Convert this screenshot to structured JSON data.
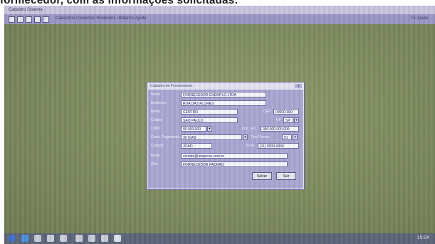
{
  "caption": "formecedor, com as informações solicitadas:",
  "app": {
    "title": "Cadastro Sistema",
    "toolbar_text": "Cadastros Consultas Relatorios Utilitarios Ajuda",
    "toolbar_right": "F1 Ajuda"
  },
  "dialog": {
    "title": "Cadastro de Fornecedores",
    "close_label": "x",
    "fields": [
      {
        "label": "Nome",
        "value": "FORNECEDOR EXEMPLO LTDA"
      },
      {
        "label": "Endereço",
        "value": "RUA DAS FLORES"
      },
      {
        "label": "Bairro",
        "value": "CENTRO",
        "sub_label": "CEP",
        "sub_value": "00000-000"
      },
      {
        "label": "Cidade",
        "value": "SAO PAULO",
        "sub_label": "UF",
        "sub_value": "SP"
      },
      {
        "label": "CNPJ",
        "value": "00.000.000",
        "sub_label": "Insc. Est.",
        "sub_value": "000.000.000.000"
      },
      {
        "label": "Cond. Pagamento",
        "value": "30 DIAS",
        "sub_label": "Tipo Fornec.",
        "sub_value": "01"
      },
      {
        "label": "Contato",
        "value": "JOAO",
        "sub_label": "Fone",
        "sub_value": "(11) 0000-0000"
      },
      {
        "label": "Email",
        "value": "contato@empresa.com.br"
      },
      {
        "label": "Obs",
        "value": "FORNECEDOR PADRAO"
      }
    ],
    "buttons": {
      "save": "Salvar",
      "cancel": "Sair"
    }
  },
  "taskbar": {
    "clock": "15:04"
  },
  "colors": {
    "desktop": "#7f8c60",
    "dialog_bg": "#a9a6d2",
    "taskbar": "#5c6478",
    "toolbar": "#9a96c4"
  }
}
